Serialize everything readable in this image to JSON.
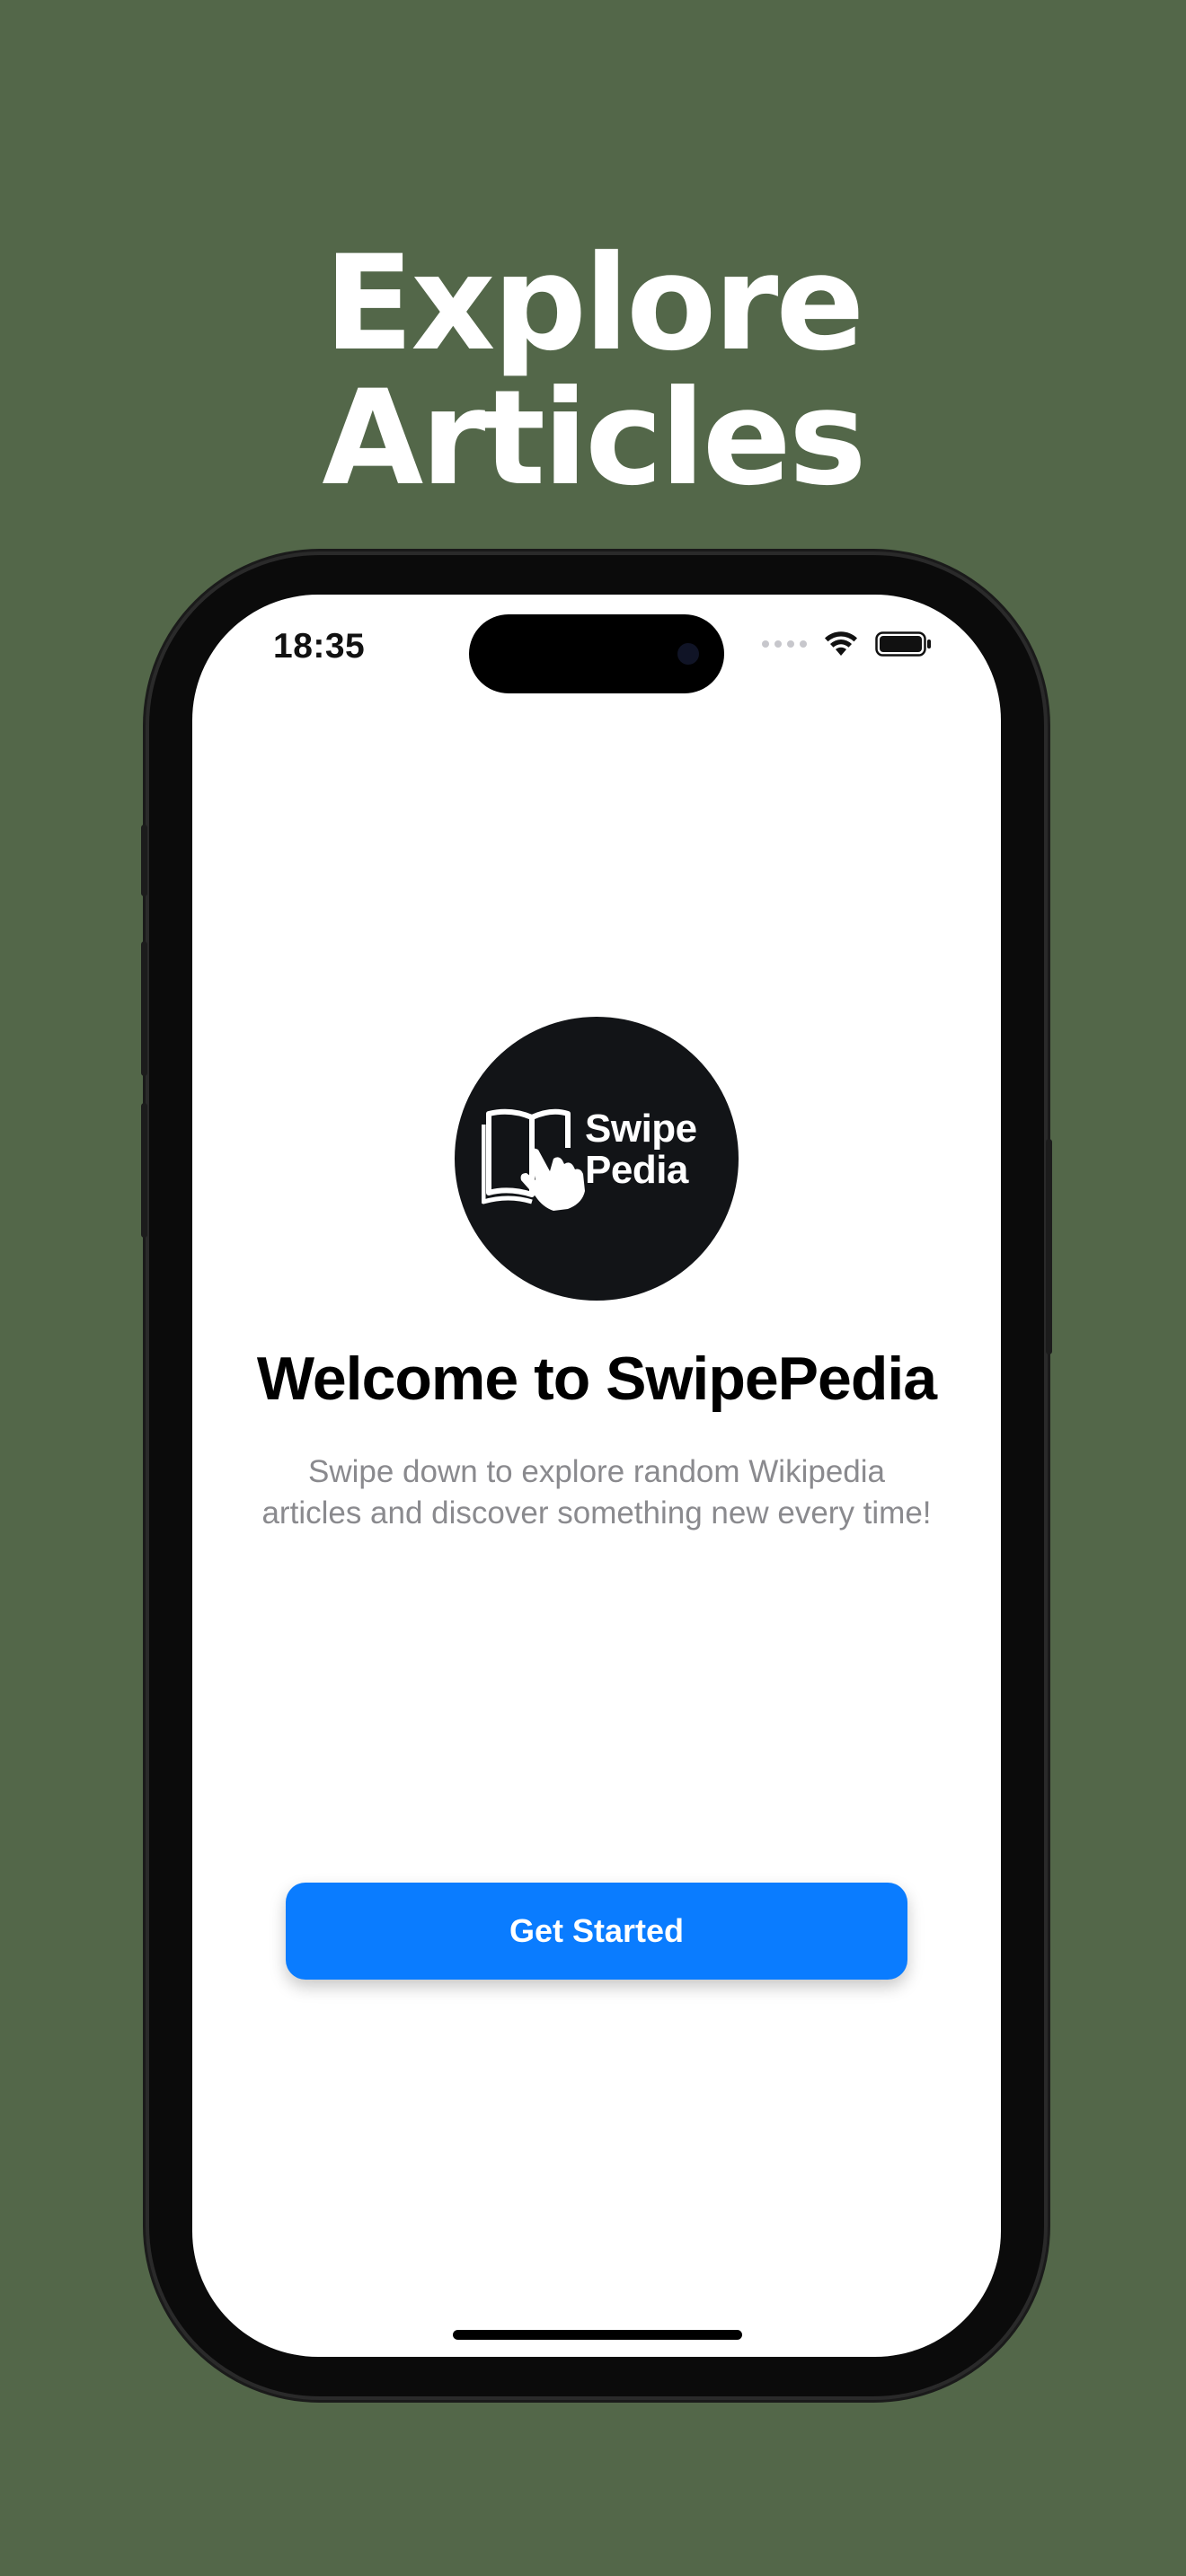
{
  "promo": {
    "headline_line1": "Explore",
    "headline_line2": "Articles"
  },
  "status_bar": {
    "time": "18:35"
  },
  "app": {
    "logo_text_line1": "Swipe",
    "logo_text_line2": "Pedia",
    "welcome_title": "Welcome to SwipePedia",
    "subtitle_line1": "Swipe down to explore random Wikipedia",
    "subtitle_line2": "articles and discover something new every time!",
    "cta_label": "Get Started"
  },
  "colors": {
    "background": "#536749",
    "accent": "#0a7cff",
    "logo_background": "#121417",
    "subtitle_text": "#8a8a8e"
  },
  "icons": [
    "wifi-icon",
    "battery-icon",
    "cellular-signal-icon",
    "book-hand-logo-icon"
  ]
}
